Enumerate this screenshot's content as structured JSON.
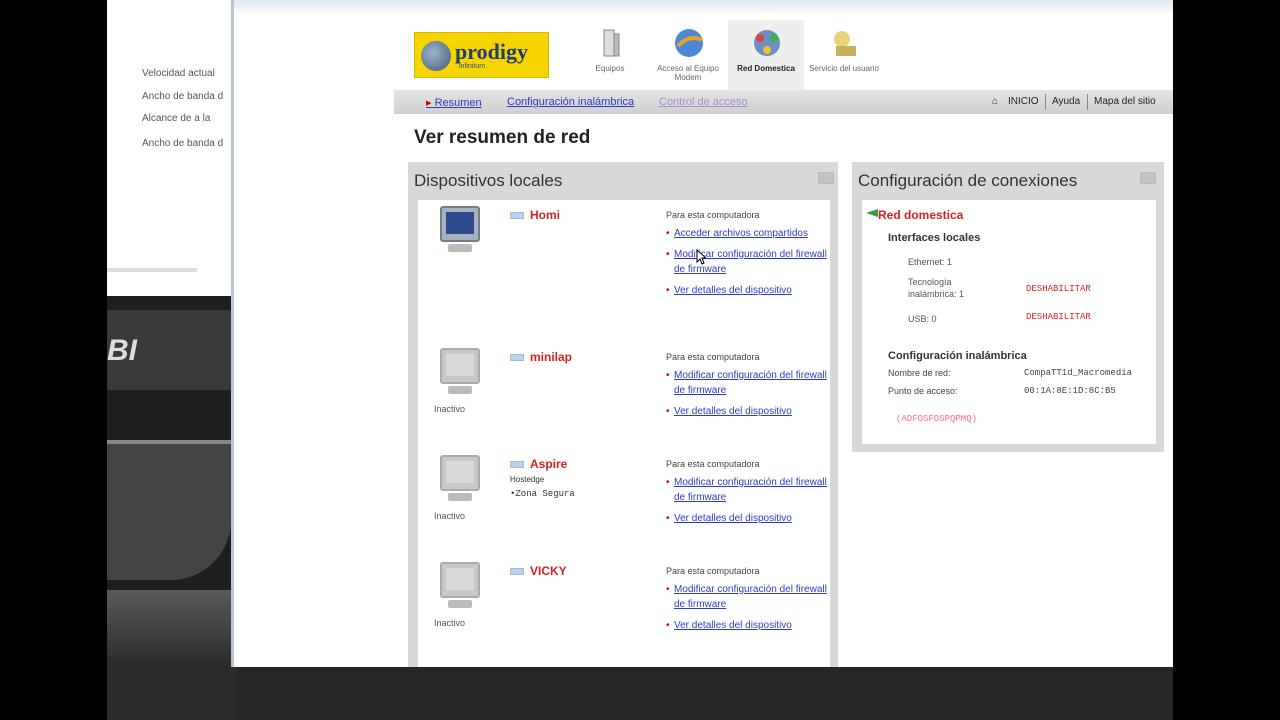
{
  "left_window": {
    "lines": [
      "Velocidad actual",
      "Ancho de banda d",
      "Alcance de a la",
      "Ancho de banda d"
    ],
    "logo_text": "BI"
  },
  "header": {
    "brand": "prodigy",
    "brand_sub": "infinitum",
    "nav_icons": [
      {
        "label": "Equipos",
        "icon": "tower-icon",
        "active": false
      },
      {
        "label": "Acceso al Equipo Modem",
        "icon": "globe-icon",
        "active": false
      },
      {
        "label": "Red Domestica",
        "icon": "network-icon",
        "active": true
      },
      {
        "label": "Servicio del usuario",
        "icon": "service-icon",
        "active": false
      }
    ]
  },
  "navbar": {
    "links": [
      "Resumen",
      "Configuración inalámbrica",
      "Control de acceso"
    ],
    "right": [
      "INICIO",
      "Ayuda",
      "Mapa del sitio"
    ]
  },
  "page_title": "Ver resumen de red",
  "devices_panel": {
    "title": "Dispositivos locales",
    "devices": [
      {
        "name": "Homi",
        "status": "",
        "sub": "",
        "sub2": "",
        "active": true,
        "actions_header": "Para esta computadora",
        "actions": [
          "Acceder archivos compartidos",
          "Modificar configuración del firewall de firmware",
          "Ver detalles del dispositivo"
        ]
      },
      {
        "name": "minilap",
        "status": "Inactivo",
        "sub": "",
        "sub2": "",
        "active": false,
        "actions_header": "Para esta computadora",
        "actions": [
          "Modificar configuración del firewall de firmware",
          "Ver detalles del dispositivo"
        ]
      },
      {
        "name": "Aspire",
        "status": "Inactivo",
        "sub": "Hostedge",
        "sub2": "•Zona Segura",
        "active": false,
        "actions_header": "Para esta computadora",
        "actions": [
          "Modificar configuración del firewall de firmware",
          "Ver detalles del dispositivo"
        ]
      },
      {
        "name": "VICKY",
        "status": "Inactivo",
        "sub": "",
        "sub2": "",
        "active": false,
        "actions_header": "Para esta computadora",
        "actions": [
          "Modificar configuración del firewall de firmware",
          "Ver detalles del dispositivo"
        ]
      }
    ]
  },
  "connections_panel": {
    "title": "Configuración de conexiones",
    "network_name": "Red domestica",
    "local_interfaces_title": "Interfaces locales",
    "interfaces": [
      {
        "label": "Ethernet: 1",
        "value": ""
      },
      {
        "label": "Tecnología inalámbrica: 1",
        "value": "DESHABILITAR"
      },
      {
        "label": "USB: 0",
        "value": "DESHABILITAR"
      }
    ],
    "wireless_title": "Configuración inalámbrica",
    "ssid_label": "Nombre de red:",
    "ssid_value": "CompaTT1d_Macromedia",
    "ap_label": "Punto de acceso:",
    "ap_value": "00:1A:8E:1D:8C:B5",
    "security_link": "(ADFOSFOSPQPMQ)"
  },
  "colors": {
    "link": "#2c3cc8",
    "device_name": "#d42222",
    "panel_bg": "#d8d8d8",
    "brand_yellow": "#f5d400"
  }
}
